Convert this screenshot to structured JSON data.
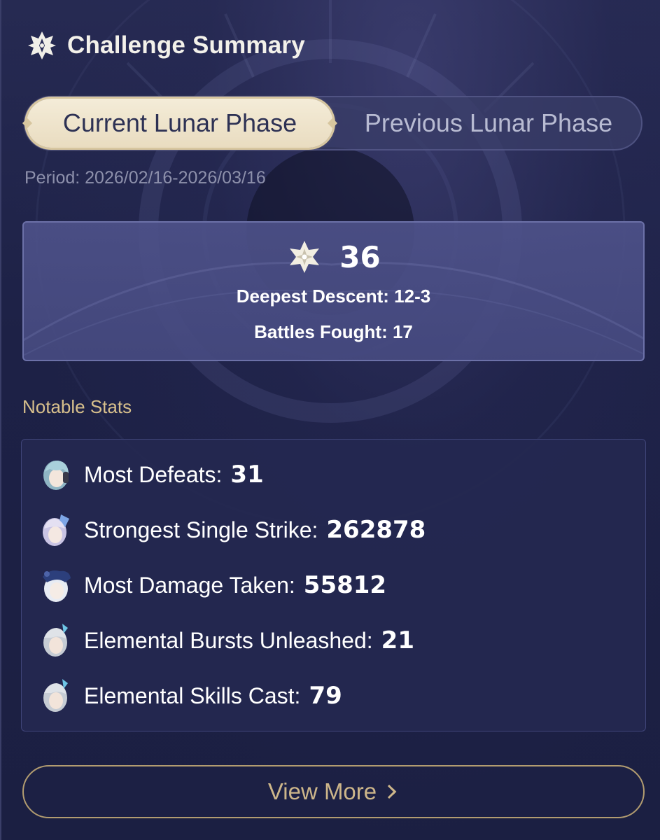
{
  "header": {
    "title": "Challenge Summary",
    "icon": "abyss-emblem-icon"
  },
  "tabs": [
    {
      "label": "Current Lunar Phase",
      "active": true
    },
    {
      "label": "Previous Lunar Phase",
      "active": false
    }
  ],
  "period": "Period: 2026/02/16-2026/03/16",
  "summary": {
    "stars": "36",
    "star_icon": "abyss-star-icon",
    "deepest_descent": "Deepest Descent: 12-3",
    "battles_fought": "Battles Fought: 17"
  },
  "notable": {
    "title": "Notable Stats",
    "stats": [
      {
        "label": "Most Defeats:",
        "value": "31",
        "icon": "character-avatar-icon"
      },
      {
        "label": "Strongest Single Strike:",
        "value": "262878",
        "icon": "character-avatar-icon"
      },
      {
        "label": "Most Damage Taken:",
        "value": "55812",
        "icon": "character-avatar-icon"
      },
      {
        "label": "Elemental Bursts Unleashed:",
        "value": "21",
        "icon": "character-avatar-icon"
      },
      {
        "label": "Elemental Skills Cast:",
        "value": "79",
        "icon": "character-avatar-icon"
      }
    ]
  },
  "view_more": {
    "label": "View More",
    "icon": "chevron-right-icon"
  },
  "colors": {
    "background": "#1d2146",
    "tab_active_bg": "#f4ecd8",
    "gold_text": "#d8c08c",
    "muted_text": "#8d90ab",
    "summary_box": "#4e528a"
  }
}
